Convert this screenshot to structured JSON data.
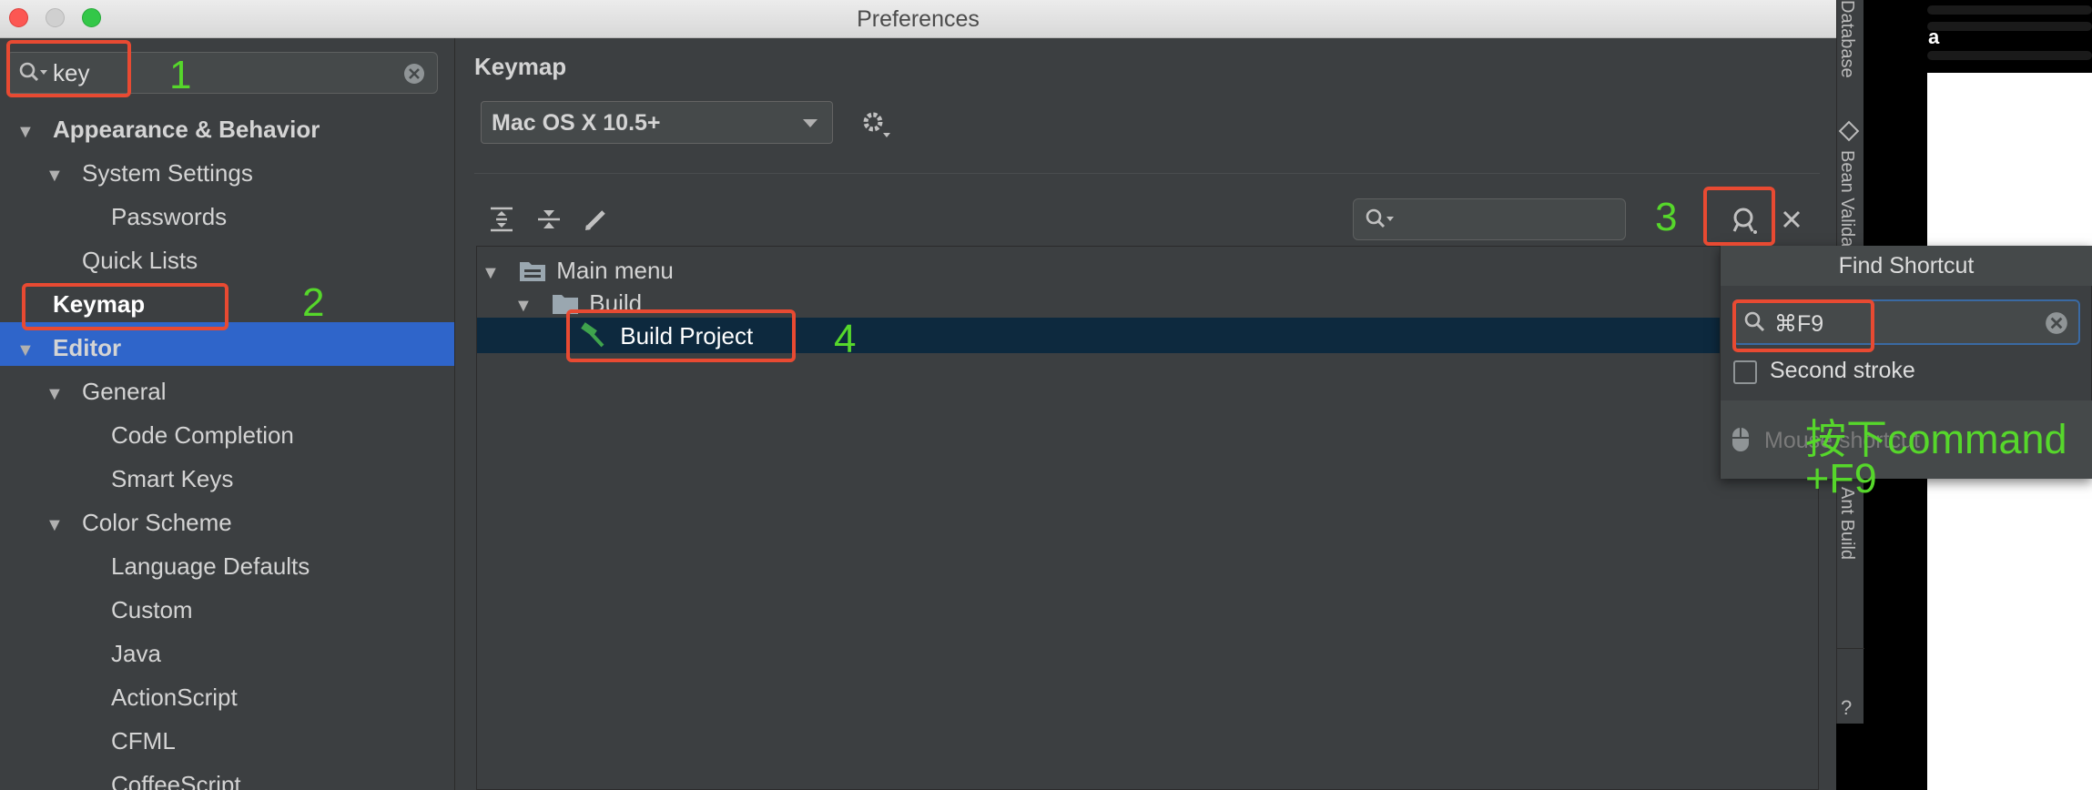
{
  "window": {
    "title": "Preferences"
  },
  "sidebar": {
    "search_value": "key",
    "items": [
      {
        "label": "Appearance & Behavior",
        "bold": true,
        "arrow": "▼"
      },
      {
        "label": "System Settings",
        "arrow": "▼"
      },
      {
        "label": "Passwords"
      },
      {
        "label": "Quick Lists"
      },
      {
        "label": "Keymap",
        "bold": true,
        "selected": true
      },
      {
        "label": "Editor",
        "bold": true,
        "arrow": "▼"
      },
      {
        "label": "General",
        "arrow": "▼"
      },
      {
        "label": "Code Completion"
      },
      {
        "label": "Smart Keys"
      },
      {
        "label": "Color Scheme",
        "arrow": "▼"
      },
      {
        "label": "Language Defaults"
      },
      {
        "label": "Custom"
      },
      {
        "label": "Java"
      },
      {
        "label": "ActionScript"
      },
      {
        "label": "CFML"
      },
      {
        "label": "CoffeeScript"
      }
    ]
  },
  "keymap": {
    "title": "Keymap",
    "scheme": "Mac OS X 10.5+",
    "tree": [
      {
        "label": "Main menu",
        "icon": "menu-folder-icon"
      },
      {
        "label": "Build",
        "icon": "folder-icon"
      },
      {
        "label": "Build Project",
        "icon": "hammer-icon",
        "selected": true
      }
    ],
    "filter_value": ""
  },
  "find_shortcut": {
    "title": "Find Shortcut",
    "shortcut": "⌘F9",
    "second_stroke": "Second stroke",
    "mouse_shortcut": "Mouse shortcut"
  },
  "tool_strip": {
    "database": "Database",
    "bean_validation": "Bean Validation",
    "ant_build": "Ant Build",
    "help": "?"
  },
  "background_window": {
    "text": "a"
  },
  "annotations": {
    "n1": "1",
    "n2": "2",
    "n3": "3",
    "n4": "4",
    "note": "按下command",
    "note2": "+F9",
    "color": "#56d72b",
    "box_color": "#e84a32"
  },
  "colors": {
    "selection": "#2f65ca",
    "panel": "#3c3f41",
    "row_selected": "#0d293e"
  }
}
